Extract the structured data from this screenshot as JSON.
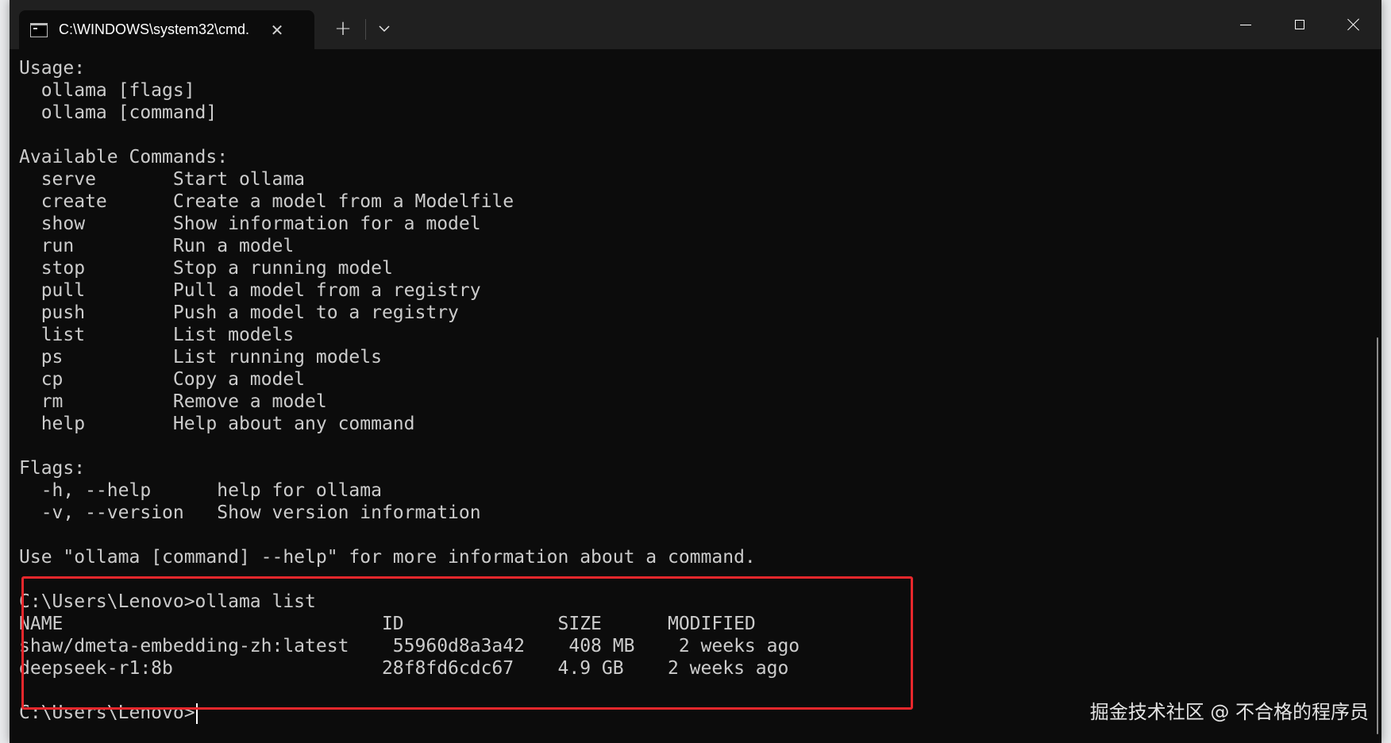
{
  "window": {
    "tab_title": "C:\\WINDOWS\\system32\\cmd.",
    "close_tab_glyph": "✕",
    "new_tab_glyph": "+",
    "dropdown_glyph": "⌄",
    "icons": [
      "cmd-icon",
      "close-tab-icon",
      "plus-icon",
      "chevron-down-icon",
      "minimize-icon",
      "maximize-icon",
      "close-window-icon"
    ]
  },
  "terminal": {
    "lines": [
      "Usage:",
      "  ollama [flags]",
      "  ollama [command]",
      "",
      "Available Commands:",
      "  serve       Start ollama",
      "  create      Create a model from a Modelfile",
      "  show        Show information for a model",
      "  run         Run a model",
      "  stop        Stop a running model",
      "  pull        Pull a model from a registry",
      "  push        Push a model to a registry",
      "  list        List models",
      "  ps          List running models",
      "  cp          Copy a model",
      "  rm          Remove a model",
      "  help        Help about any command",
      "",
      "Flags:",
      "  -h, --help      help for ollama",
      "  -v, --version   Show version information",
      "",
      "Use \"ollama [command] --help\" for more information about a command.",
      "",
      "C:\\Users\\Lenovo>ollama list",
      "NAME                             ID              SIZE      MODIFIED",
      "shaw/dmeta-embedding-zh:latest    55960d8a3a42    408 MB    2 weeks ago",
      "deepseek-r1:8b                   28f8fd6cdc67    4.9 GB    2 weeks ago",
      "",
      "C:\\Users\\Lenovo>"
    ]
  },
  "watermark": "掘金技术社区 @ 不合格的程序员",
  "colors": {
    "terminal_bg": "#0c0c0c",
    "terminal_fg": "#cccccc",
    "titlebar_bg": "#202020",
    "highlight": "#e8272c"
  }
}
